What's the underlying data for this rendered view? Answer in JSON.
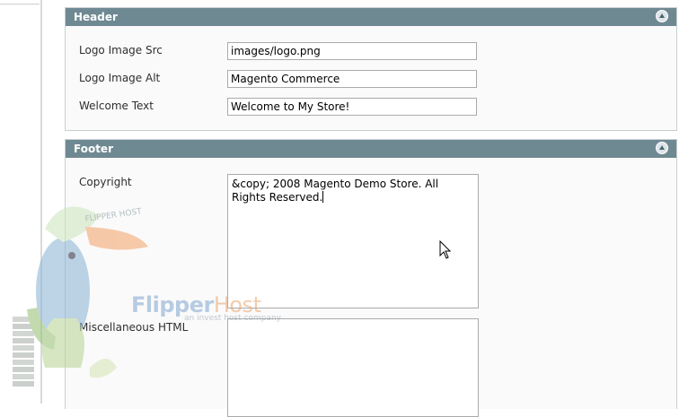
{
  "sections": {
    "header": {
      "title": "Header",
      "fields": {
        "logo_src": {
          "label": "Logo Image Src",
          "value": "images/logo.png"
        },
        "logo_alt": {
          "label": "Logo Image Alt",
          "value": "Magento Commerce"
        },
        "welcome": {
          "label": "Welcome Text",
          "value": "Welcome to My Store!"
        }
      }
    },
    "footer": {
      "title": "Footer",
      "fields": {
        "copyright": {
          "label": "Copyright",
          "value": "&copy; 2008 Magento Demo Store. All Rights Reserved."
        },
        "misc_html": {
          "label": "Miscellaneous HTML",
          "value": ""
        }
      }
    }
  },
  "watermark": {
    "brand": "Flipper",
    "brand_suffix": "Host",
    "tagline": "an invest host company",
    "cap_text": "FLIPPER HOST"
  },
  "colors": {
    "section_header_bg": "#6f8992",
    "section_bg": "#fafafa",
    "border": "#c8cfd3"
  }
}
